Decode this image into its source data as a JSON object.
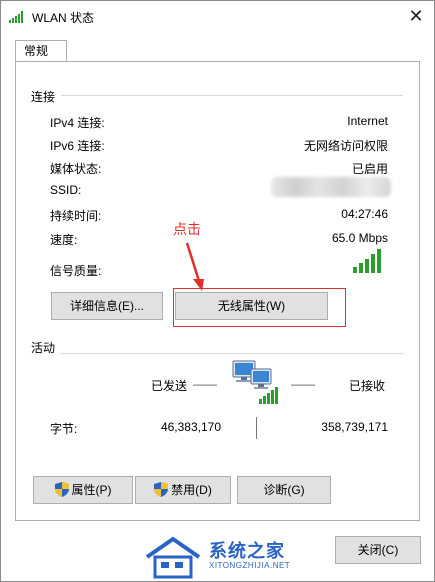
{
  "window": {
    "title": "WLAN 状态",
    "close_glyph": "✕"
  },
  "tabs": [
    {
      "label": "常规"
    }
  ],
  "connection": {
    "group_title": "连接",
    "rows": [
      {
        "label": "IPv4 连接:",
        "value": "Internet"
      },
      {
        "label": "IPv6 连接:",
        "value": "无网络访问权限"
      },
      {
        "label": "媒体状态:",
        "value": "已启用"
      },
      {
        "label": "SSID:",
        "value": ""
      },
      {
        "label": "持续时间:",
        "value": "04:27:46"
      },
      {
        "label": "速度:",
        "value": "65.0 Mbps"
      },
      {
        "label": "信号质量:",
        "value": ""
      }
    ],
    "details_button": "详细信息(E)...",
    "wireless_props_button": "无线属性(W)",
    "signal_bars": 5
  },
  "annotation": {
    "text": "点击",
    "color": "#e0302b"
  },
  "activity": {
    "group_title": "活动",
    "sent_label": "已发送",
    "received_label": "已接收",
    "dash_left": "——",
    "dash_right": "——",
    "bytes_label": "字节:",
    "bytes_sent": "46,383,170",
    "bytes_received": "358,739,171"
  },
  "actions": {
    "properties": "属性(P)",
    "disable": "禁用(D)",
    "diagnose": "诊断(G)"
  },
  "footer": {
    "close_button": "关闭(C)"
  },
  "watermark": {
    "text": "系统之家",
    "url": "XITONGZHIJIA.NET"
  },
  "icons": {
    "title": "wifi-signal-icon",
    "shield": "uac-shield-icon",
    "network": "network-computers-icon",
    "signal": "signal-bars-icon"
  },
  "colors": {
    "accent_red": "#e0302b",
    "signal_green": "#2d9e2d",
    "button_bg": "#e1e1e1"
  }
}
